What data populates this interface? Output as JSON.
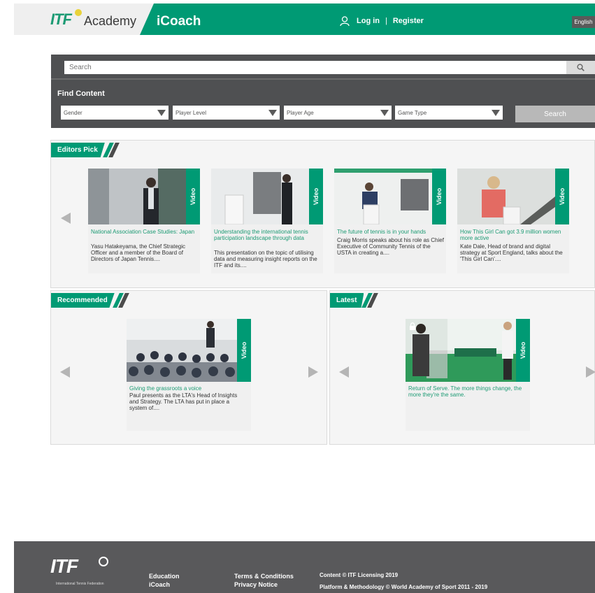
{
  "header": {
    "logo_itf": "ITF",
    "logo_academy": "Academy",
    "app_title": "iCoach",
    "login": "Log in",
    "separator": "|",
    "register": "Register",
    "language": "English"
  },
  "search": {
    "placeholder": "Search"
  },
  "find_content": {
    "title": "Find Content",
    "filters": [
      "Gender",
      "Player Level",
      "Player Age",
      "Game Type"
    ],
    "search_label": "Search"
  },
  "editors_pick": {
    "label": "Editors Pick",
    "cards": [
      {
        "badge": "Video",
        "title": "National Association Case Studies: Japan",
        "desc": "Yasu Hatakeyama, the Chief Strategic Officer and a member of the Board of Directors of Japan Tennis...."
      },
      {
        "badge": "Video",
        "title": "Understanding the international tennis participation landscape through data",
        "desc": "This presentation on the topic of utilising data and measuring insight reports on the ITF and its...."
      },
      {
        "badge": "Video",
        "title": "The future of tennis is in your hands",
        "desc": "Craig Morris speaks about his role as Chief Executive of Community Tennis of the USTA in creating a...."
      },
      {
        "badge": "Video",
        "title": "How This Girl Can got 3.9 million women more active",
        "desc": "Kate Dale, Head of brand and digital strategy at Sport England, talks about the 'This Girl Can'...."
      }
    ]
  },
  "recommended": {
    "label": "Recommended",
    "card": {
      "badge": "Video",
      "title": "Giving the grassroots a voice",
      "desc": "Paul presents as the LTA's Head of Insights and Strategy. The LTA has put in place a system of...."
    }
  },
  "latest": {
    "label": "Latest",
    "card": {
      "badge": "Video",
      "title": "Return of Serve. The more things change, the more they're the same.",
      "desc": ""
    }
  },
  "footer": {
    "logo": "ITF",
    "logo_sub": "International Tennis Federation",
    "col1": [
      "Education",
      "iCoach"
    ],
    "col2": [
      "Terms & Conditions",
      "Privacy Notice"
    ],
    "col3": [
      "Content © ITF Licensing 2019",
      "Platform & Methodology © World Academy of Sport 2011 - 2019"
    ]
  },
  "colors": {
    "brand_green": "#009a74",
    "panel_dark": "#4f5052",
    "footer": "#59595b"
  }
}
